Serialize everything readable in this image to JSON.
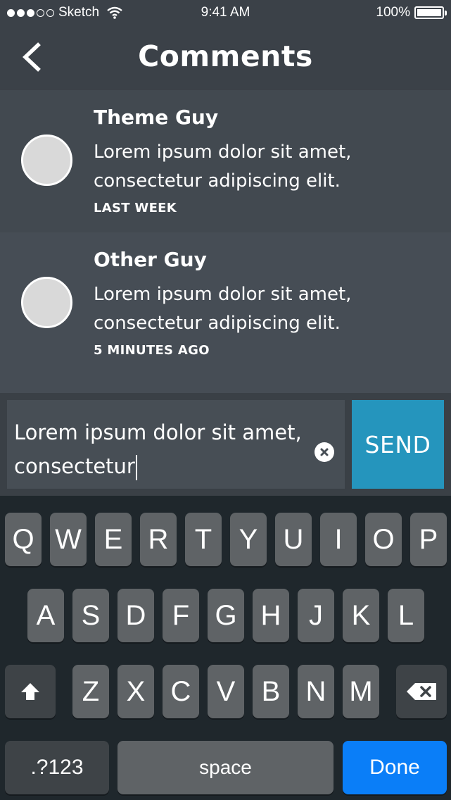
{
  "status_bar": {
    "carrier": "Sketch",
    "time": "9:41 AM",
    "battery": "100%",
    "battery_level": 1.0,
    "signal_bars": 5,
    "signal_filled": 3
  },
  "nav": {
    "title": "Comments",
    "back_icon": "chevron-left-icon"
  },
  "comments": [
    {
      "author": "Theme Guy",
      "text": "Lorem ipsum dolor sit amet, consectetur adipiscing elit.",
      "time": "LAST WEEK"
    },
    {
      "author": "Other Guy",
      "text": "Lorem ipsum dolor sit amet, consectetur adipiscing elit.",
      "time": "5 MINUTES AGO"
    }
  ],
  "composer": {
    "value": "Lorem ipsum dolor sit amet, consectetur",
    "clear_icon": "clear-x-icon",
    "send_label": "SEND"
  },
  "keyboard": {
    "row1": [
      "Q",
      "W",
      "E",
      "R",
      "T",
      "Y",
      "U",
      "I",
      "O",
      "P"
    ],
    "row2": [
      "A",
      "S",
      "D",
      "F",
      "G",
      "H",
      "J",
      "K",
      "L"
    ],
    "row3": [
      "Z",
      "X",
      "C",
      "V",
      "B",
      "N",
      "M"
    ],
    "shift_icon": "shift-icon",
    "delete_icon": "backspace-icon",
    "numbers_label": ".?123",
    "space_label": "space",
    "done_label": "Done"
  },
  "colors": {
    "background": "#3b4148",
    "send_accent": "#2595bd",
    "done_accent": "#0a7ef8",
    "keyboard_bg": "#1f272c"
  }
}
